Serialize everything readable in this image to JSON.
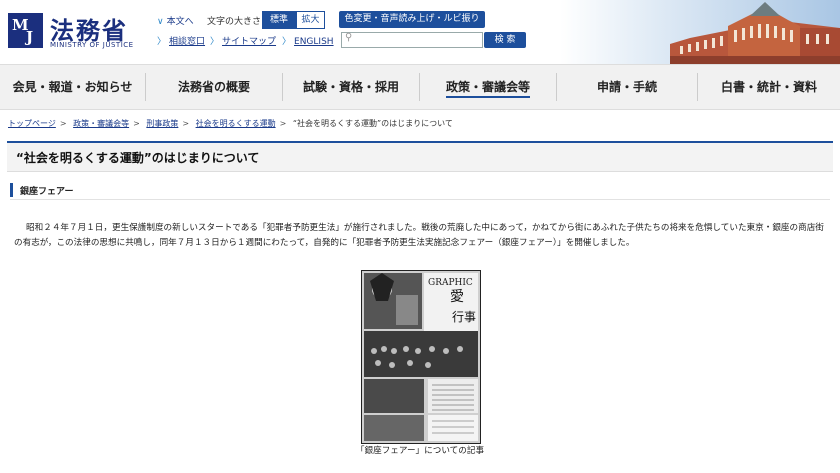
{
  "header": {
    "logo_mark": "MOJ",
    "org_name": "法務省",
    "org_name_en": "MINISTRY OF JUSTICE",
    "links_row1": [
      "本文へ"
    ],
    "font_size_label": "文字の大きさ",
    "font_size_standard": "標準",
    "font_size_large": "拡大",
    "accessibility_button": "色変更・音声読み上げ・ルビ振り",
    "links_row2": [
      "相談窓口",
      "サイトマップ",
      "ENGLISH"
    ],
    "search_placeholder": "",
    "search_button": "検 索"
  },
  "nav": {
    "items": [
      {
        "label": "会見・報道・お知らせ"
      },
      {
        "label": "法務省の概要"
      },
      {
        "label": "試験・資格・採用"
      },
      {
        "label": "政策・審議会等"
      },
      {
        "label": "申請・手続"
      },
      {
        "label": "白書・統計・資料"
      }
    ]
  },
  "breadcrumb": {
    "links": [
      "トップページ",
      "政策・審議会等",
      "刑事政策",
      "社会を明るくする運動"
    ],
    "current": "“社会を明るくする運動”のはじまりについて"
  },
  "page": {
    "title": "“社会を明るくする運動”のはじまりについて",
    "section_heading": "銀座フェアー",
    "paragraph": "昭和２４年７月１日，更生保護制度の新しいスタートである「犯罪者予防更生法」が施行されました。戦後の荒廃した中にあって，かねてから街にあふれた子供たちの将来を危惧していた東京・銀座の商店街の有志が，この法律の思想に共鳴し，同年７月１３日から１週間にわたって，自発的に「犯罪者予防更生法実施記念フェアー（銀座フェアー）」を開催しました。",
    "image_caption": "「銀座フェアー」についての記事"
  },
  "colors": {
    "brand_navy": "#1b2f7e",
    "accent_blue": "#1d4f9c"
  }
}
